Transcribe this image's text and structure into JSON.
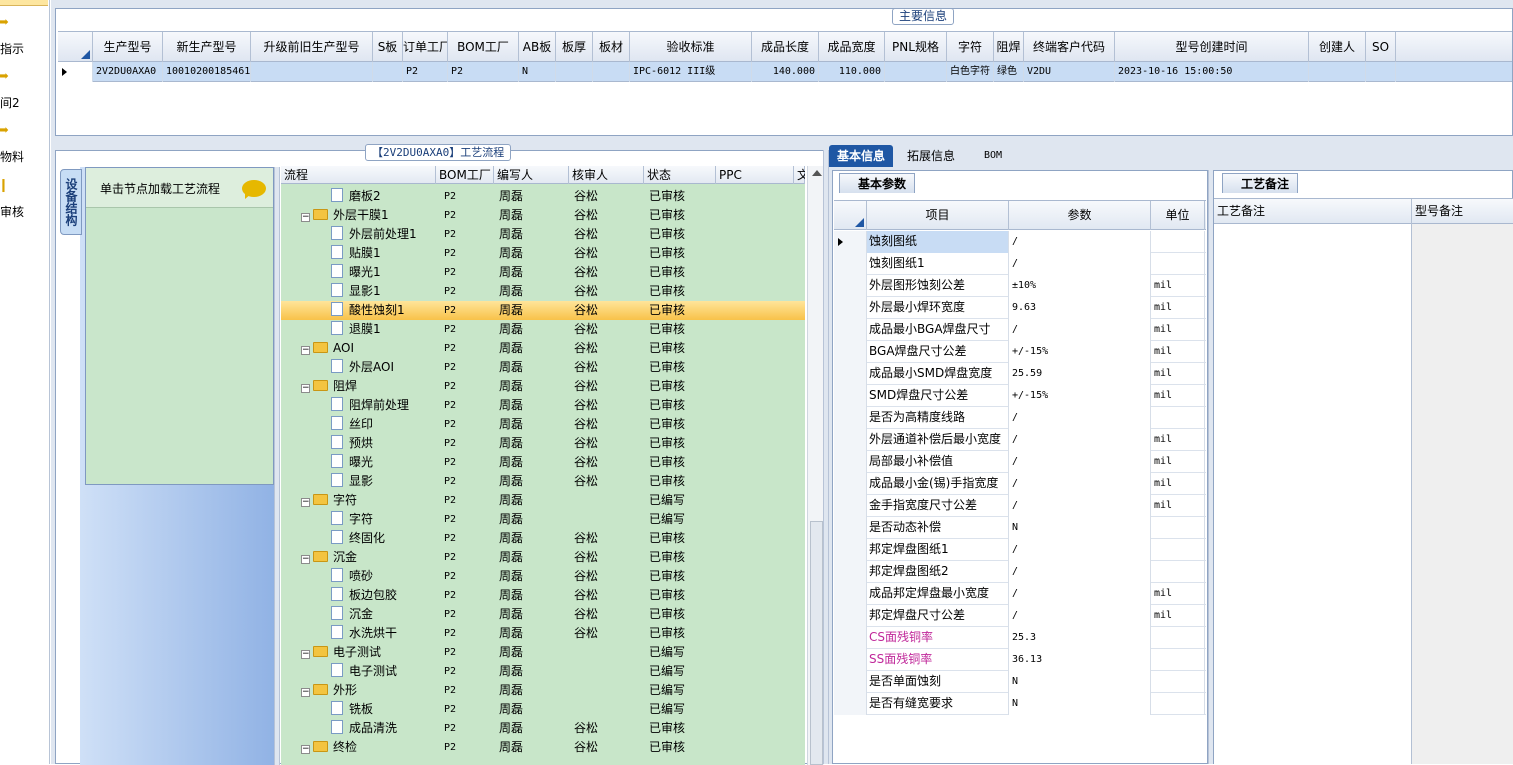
{
  "left_nav": {
    "items": [
      {
        "label": "指示",
        "icon": "arrow-icon"
      },
      {
        "label": "间2",
        "icon": "arrow-icon"
      },
      {
        "label": "物料",
        "icon": "arrow-icon"
      },
      {
        "label": "审核",
        "icon": "doc-icon"
      }
    ]
  },
  "top_panel": {
    "title": "主要信息",
    "columns": [
      "生产型号",
      "新生产型号",
      "升级前旧生产型号",
      "S板",
      "订单工厂",
      "BOM工厂",
      "AB板",
      "板厚",
      "板材",
      "验收标准",
      "成品长度",
      "成品宽度",
      "PNL规格",
      "字符",
      "阻焊",
      "终端客户代码",
      "型号创建时间",
      "创建人",
      "SO"
    ],
    "row": [
      "2V2DU0AXA0",
      "10010200185461",
      "",
      "",
      "P2",
      "P2",
      "N",
      "",
      "",
      "IPC-6012 III级",
      "140.000",
      "110.000",
      "",
      "白色字符",
      "绿色",
      "V2DU",
      "2023-10-16 15:00:50",
      "",
      ""
    ]
  },
  "flow_panel": {
    "title": "【2V2DU0AXA0】工艺流程",
    "side_tab": "设备结构",
    "node_hint": "单击节点加载工艺流程",
    "tree_headers": [
      "流程",
      "BOM工厂",
      "编写人",
      "核审人",
      "状态",
      "PPC",
      "文"
    ],
    "tree_rows": [
      {
        "name": "磨板2",
        "level": 2,
        "type": "doc",
        "bom": "P2",
        "writer": "周磊",
        "reviewer": "谷松",
        "status": "已审核"
      },
      {
        "name": "外层干膜1",
        "level": 1,
        "type": "folder",
        "bom": "P2",
        "writer": "周磊",
        "reviewer": "谷松",
        "status": "已审核"
      },
      {
        "name": "外层前处理1",
        "level": 2,
        "type": "doc",
        "bom": "P2",
        "writer": "周磊",
        "reviewer": "谷松",
        "status": "已审核"
      },
      {
        "name": "贴膜1",
        "level": 2,
        "type": "doc",
        "bom": "P2",
        "writer": "周磊",
        "reviewer": "谷松",
        "status": "已审核"
      },
      {
        "name": "曝光1",
        "level": 2,
        "type": "doc",
        "bom": "P2",
        "writer": "周磊",
        "reviewer": "谷松",
        "status": "已审核"
      },
      {
        "name": "显影1",
        "level": 2,
        "type": "doc",
        "bom": "P2",
        "writer": "周磊",
        "reviewer": "谷松",
        "status": "已审核"
      },
      {
        "name": "酸性蚀刻1",
        "level": 2,
        "type": "doc",
        "bom": "P2",
        "writer": "周磊",
        "reviewer": "谷松",
        "status": "已审核",
        "selected": true
      },
      {
        "name": "退膜1",
        "level": 2,
        "type": "doc",
        "bom": "P2",
        "writer": "周磊",
        "reviewer": "谷松",
        "status": "已审核"
      },
      {
        "name": "AOI",
        "level": 1,
        "type": "folder",
        "bom": "P2",
        "writer": "周磊",
        "reviewer": "谷松",
        "status": "已审核"
      },
      {
        "name": "外层AOI",
        "level": 2,
        "type": "doc",
        "bom": "P2",
        "writer": "周磊",
        "reviewer": "谷松",
        "status": "已审核"
      },
      {
        "name": "阻焊",
        "level": 1,
        "type": "folder",
        "bom": "P2",
        "writer": "周磊",
        "reviewer": "谷松",
        "status": "已审核"
      },
      {
        "name": "阻焊前处理",
        "level": 2,
        "type": "doc",
        "bom": "P2",
        "writer": "周磊",
        "reviewer": "谷松",
        "status": "已审核"
      },
      {
        "name": "丝印",
        "level": 2,
        "type": "doc",
        "bom": "P2",
        "writer": "周磊",
        "reviewer": "谷松",
        "status": "已审核"
      },
      {
        "name": "预烘",
        "level": 2,
        "type": "doc",
        "bom": "P2",
        "writer": "周磊",
        "reviewer": "谷松",
        "status": "已审核"
      },
      {
        "name": "曝光",
        "level": 2,
        "type": "doc",
        "bom": "P2",
        "writer": "周磊",
        "reviewer": "谷松",
        "status": "已审核"
      },
      {
        "name": "显影",
        "level": 2,
        "type": "doc",
        "bom": "P2",
        "writer": "周磊",
        "reviewer": "谷松",
        "status": "已审核"
      },
      {
        "name": "字符",
        "level": 1,
        "type": "folder",
        "bom": "P2",
        "writer": "周磊",
        "reviewer": "",
        "status": "已编写"
      },
      {
        "name": "字符",
        "level": 2,
        "type": "doc",
        "bom": "P2",
        "writer": "周磊",
        "reviewer": "",
        "status": "已编写"
      },
      {
        "name": "终固化",
        "level": 2,
        "type": "doc",
        "bom": "P2",
        "writer": "周磊",
        "reviewer": "谷松",
        "status": "已审核"
      },
      {
        "name": "沉金",
        "level": 1,
        "type": "folder",
        "bom": "P2",
        "writer": "周磊",
        "reviewer": "谷松",
        "status": "已审核"
      },
      {
        "name": "喷砂",
        "level": 2,
        "type": "doc",
        "bom": "P2",
        "writer": "周磊",
        "reviewer": "谷松",
        "status": "已审核"
      },
      {
        "name": "板边包胶",
        "level": 2,
        "type": "doc",
        "bom": "P2",
        "writer": "周磊",
        "reviewer": "谷松",
        "status": "已审核"
      },
      {
        "name": "沉金",
        "level": 2,
        "type": "doc",
        "bom": "P2",
        "writer": "周磊",
        "reviewer": "谷松",
        "status": "已审核"
      },
      {
        "name": "水洗烘干",
        "level": 2,
        "type": "doc",
        "bom": "P2",
        "writer": "周磊",
        "reviewer": "谷松",
        "status": "已审核"
      },
      {
        "name": "电子测试",
        "level": 1,
        "type": "folder",
        "bom": "P2",
        "writer": "周磊",
        "reviewer": "",
        "status": "已编写"
      },
      {
        "name": "电子测试",
        "level": 2,
        "type": "doc",
        "bom": "P2",
        "writer": "周磊",
        "reviewer": "",
        "status": "已编写"
      },
      {
        "name": "外形",
        "level": 1,
        "type": "folder",
        "bom": "P2",
        "writer": "周磊",
        "reviewer": "",
        "status": "已编写"
      },
      {
        "name": "铣板",
        "level": 2,
        "type": "doc",
        "bom": "P2",
        "writer": "周磊",
        "reviewer": "",
        "status": "已编写"
      },
      {
        "name": "成品清洗",
        "level": 2,
        "type": "doc",
        "bom": "P2",
        "writer": "周磊",
        "reviewer": "谷松",
        "status": "已审核"
      },
      {
        "name": "终检",
        "level": 1,
        "type": "folder",
        "bom": "P2",
        "writer": "周磊",
        "reviewer": "谷松",
        "status": "已审核"
      }
    ]
  },
  "right_panel": {
    "tabs": [
      "基本信息",
      "拓展信息",
      "BOM"
    ],
    "param_tab": "基本参数",
    "param_headers": [
      "项目",
      "参数",
      "单位"
    ],
    "params": [
      {
        "name": "蚀刻图纸",
        "value": "/",
        "unit": ""
      },
      {
        "name": "蚀刻图纸1",
        "value": "/",
        "unit": ""
      },
      {
        "name": "外层图形蚀刻公差",
        "value": "±10%",
        "unit": "mil"
      },
      {
        "name": "外层最小焊环宽度",
        "value": "9.63",
        "unit": "mil"
      },
      {
        "name": "成品最小BGA焊盘尺寸",
        "value": "/",
        "unit": "mil"
      },
      {
        "name": "BGA焊盘尺寸公差",
        "value": "+/-15%",
        "unit": "mil"
      },
      {
        "name": "成品最小SMD焊盘宽度",
        "value": "25.59",
        "unit": "mil"
      },
      {
        "name": "SMD焊盘尺寸公差",
        "value": "+/-15%",
        "unit": "mil"
      },
      {
        "name": "是否为高精度线路",
        "value": "/",
        "unit": ""
      },
      {
        "name": "外层通道补偿后最小宽度",
        "value": "/",
        "unit": "mil"
      },
      {
        "name": "局部最小补偿值",
        "value": "/",
        "unit": "mil"
      },
      {
        "name": "成品最小金(锡)手指宽度",
        "value": "/",
        "unit": "mil"
      },
      {
        "name": "金手指宽度尺寸公差",
        "value": "/",
        "unit": "mil"
      },
      {
        "name": "是否动态补偿",
        "value": "N",
        "unit": ""
      },
      {
        "name": "邦定焊盘图纸1",
        "value": "/",
        "unit": ""
      },
      {
        "name": "邦定焊盘图纸2",
        "value": "/",
        "unit": ""
      },
      {
        "name": "成品邦定焊盘最小宽度",
        "value": "/",
        "unit": "mil"
      },
      {
        "name": "邦定焊盘尺寸公差",
        "value": "/",
        "unit": "mil"
      },
      {
        "name": "CS面残铜率",
        "value": "25.3",
        "unit": "",
        "highlight": true
      },
      {
        "name": "SS面残铜率",
        "value": "36.13",
        "unit": "",
        "highlight": true
      },
      {
        "name": "是否单面蚀刻",
        "value": "N",
        "unit": ""
      },
      {
        "name": "是否有缝宽要求",
        "value": "N",
        "unit": ""
      }
    ],
    "notes_tab": "工艺备注",
    "notes_headers": [
      "工艺备注",
      "型号备注"
    ]
  }
}
